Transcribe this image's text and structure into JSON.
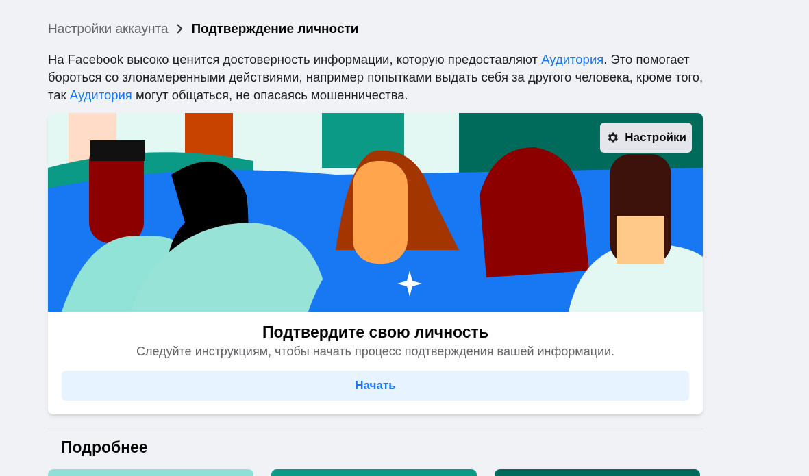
{
  "breadcrumb": [
    {
      "label": "Настройки аккаунта",
      "selected": false
    },
    {
      "label": "Подтверждение личности",
      "selected": true
    }
  ],
  "intro": [
    {
      "kind": "text",
      "text": "На Facebook высоко ценится достоверность информации, которую предоставляют "
    },
    {
      "kind": "link",
      "text": "Аудитория"
    },
    {
      "kind": "text",
      "text": ". Это помогает бороться со злонамеренными действиями, например попытками выдать себя за другого человека, кроме того, так "
    },
    {
      "kind": "link",
      "text": "Аудитория"
    },
    {
      "kind": "text",
      "text": " могут общаться, не опасаясь мошенничества."
    }
  ],
  "card": {
    "settings_button": "Настройки",
    "title": "Подтвердите свою личность",
    "subtitle": "Следуйте инструкциям, чтобы начать процесс подтверждения вашей информации.",
    "action_button": "Начать"
  },
  "more": {
    "title": "Подробнее",
    "previews": [
      {
        "color": "#8fe0d6"
      },
      {
        "color": "#0b9a86"
      },
      {
        "color": "#006b5a"
      }
    ]
  }
}
